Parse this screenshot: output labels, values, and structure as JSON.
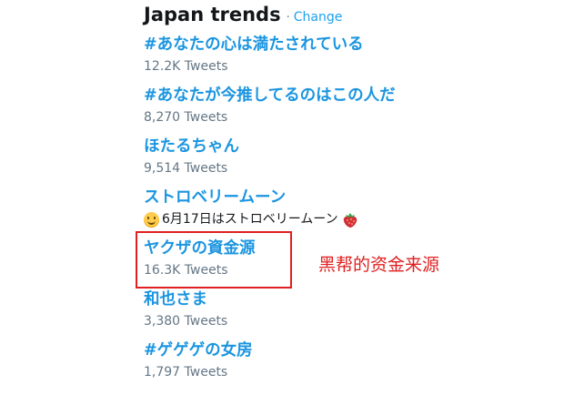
{
  "header": {
    "title": "Japan trends",
    "separator": "·",
    "change_label": "Change"
  },
  "trends": [
    {
      "name": "#あなたの心は満たされている",
      "meta": "12.2K Tweets"
    },
    {
      "name": "#あなたが今推してるのはこの人だ",
      "meta": "8,270 Tweets"
    },
    {
      "name": "ほたるちゃん",
      "meta": "9,514 Tweets"
    },
    {
      "name": "ストロベリームーン",
      "description": "6月17日はストロベリームーン",
      "description_icons": [
        "smiling-face-icon",
        "strawberry-icon"
      ]
    },
    {
      "name": "ヤクザの資金源",
      "meta": "16.3K Tweets"
    },
    {
      "name": "和也さま",
      "meta": "3,380 Tweets"
    },
    {
      "name": "#ゲゲゲの女房",
      "meta": "1,797 Tweets"
    }
  ],
  "annotation": {
    "text": "黑帮的资金来源",
    "color": "#e02020"
  },
  "colors": {
    "link": "#1b95e0",
    "muted": "#657786",
    "title": "#14171a",
    "highlight": "#e02020"
  }
}
